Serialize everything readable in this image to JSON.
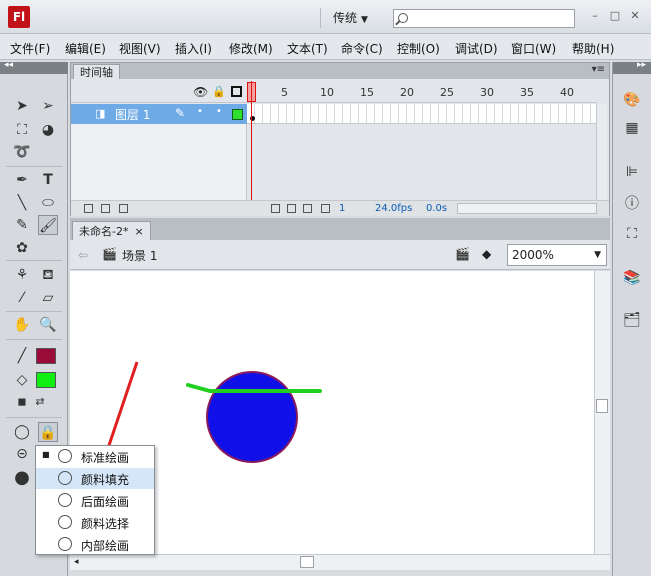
{
  "app": {
    "logo": "Fl",
    "workspace": "传统",
    "search_placeholder": ""
  },
  "menu": [
    "文件(F)",
    "编辑(E)",
    "视图(V)",
    "插入(I)",
    "修改(M)",
    "文本(T)",
    "命令(C)",
    "控制(O)",
    "调试(D)",
    "窗口(W)",
    "帮助(H)"
  ],
  "timeline": {
    "tab": "时间轴",
    "ruler": [
      "1",
      "5",
      "10",
      "15",
      "20",
      "25",
      "30",
      "35",
      "40"
    ],
    "layer_name": "图层 1",
    "current_frame": "1",
    "fps": "24.0fps",
    "time": "0.0s"
  },
  "document": {
    "tab": "未命名-2*",
    "tab_close": "×",
    "scene": "场景 1",
    "zoom": "2000%"
  },
  "colors": {
    "stroke": "#9b0b3a",
    "fill": "#11ee11",
    "circle_fill": "#1010e8",
    "circle_stroke": "#8a1a5c",
    "line_stroke": "#22d022",
    "arrow": "#e02020",
    "layer_highlight": "#6eaae6"
  },
  "brush_mode_menu": {
    "items": [
      {
        "label": "标准绘画",
        "checked": true
      },
      {
        "label": "颜料填充",
        "checked": false
      },
      {
        "label": "后面绘画",
        "checked": false
      },
      {
        "label": "颜料选择",
        "checked": false
      },
      {
        "label": "内部绘画",
        "checked": false
      }
    ]
  },
  "icons": {
    "tools": [
      "selection-tool-icon",
      "subselection-tool-icon",
      "free-transform-icon",
      "3d-rotation-icon",
      "lasso-icon",
      "pen-tool-icon",
      "text-tool-icon",
      "line-tool-icon",
      "oval-tool-icon",
      "pencil-tool-icon",
      "brush-tool-icon",
      "deco-tool-icon",
      "bone-tool-icon",
      "paint-bucket-icon",
      "eyedropper-icon",
      "eraser-icon",
      "hand-tool-icon",
      "zoom-tool-icon"
    ],
    "dock": [
      "color-panel-icon",
      "swatches-icon",
      "align-icon",
      "info-icon",
      "transform-icon",
      "library-icon",
      "components-icon"
    ]
  }
}
